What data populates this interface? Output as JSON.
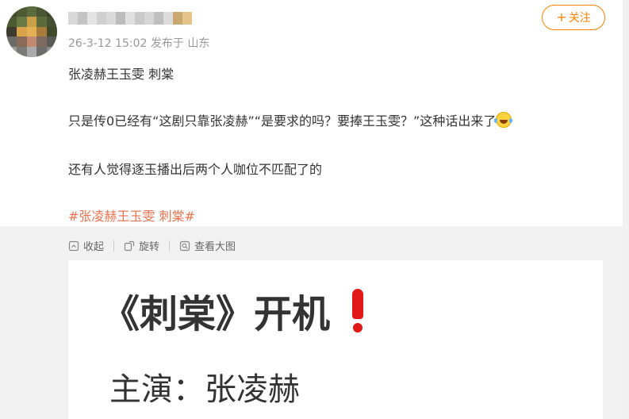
{
  "post": {
    "meta": "26-3-12 15:02 发布于 山东",
    "follow_label": "关注",
    "line1": "张凌赫王玉雯 刺棠",
    "line2": "只是传0已经有“这剧只靠张凌赫”“是要求的吗？要捧王玉雯？”这种话出来了",
    "line2_emoji": "laugh-cry-emoji",
    "line3": "还有人觉得逐玉播出后两个人咖位不匹配了的",
    "hashtag": "#张凌赫王玉雯 刺棠#"
  },
  "toolbar": {
    "collapse_label": "收起",
    "rotate_label": "旋转",
    "view_large_label": "查看大图"
  },
  "image": {
    "title": "《刺棠》开机",
    "cast": "主演：张凌赫"
  },
  "colors": {
    "accent": "#ff8200",
    "hashtag": "#eb7350",
    "meta": "#999999",
    "exclamation": "#e01818"
  }
}
